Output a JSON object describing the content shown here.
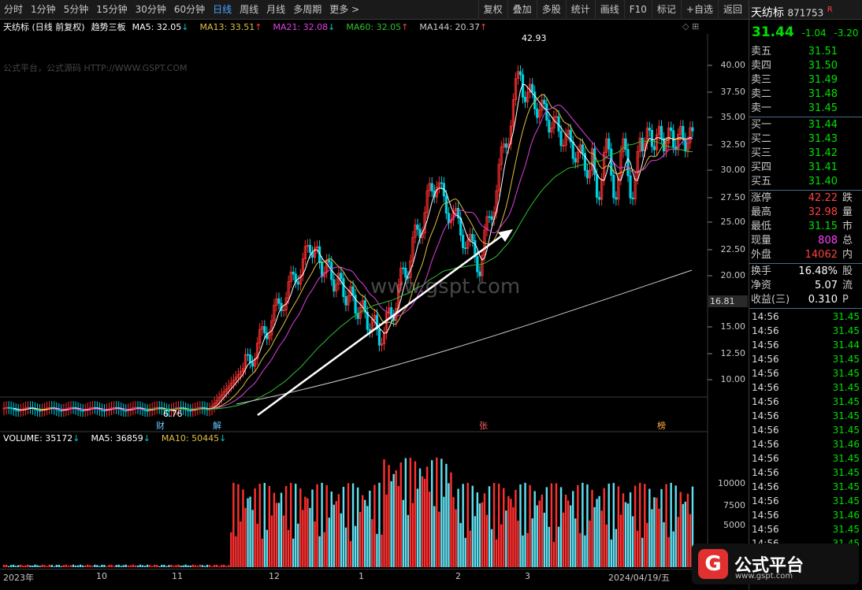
{
  "toolbar": {
    "periods": [
      "分时",
      "1分钟",
      "5分钟",
      "15分钟",
      "30分钟",
      "60分钟",
      "日线",
      "周线",
      "月线",
      "多周期",
      "更多 >"
    ],
    "active_index": 6,
    "tools": [
      "复权",
      "叠加",
      "多股",
      "统计",
      "画线",
      "F10",
      "标记",
      "+自选",
      "返回"
    ]
  },
  "chart_header": {
    "title": "天纺标 (日线 前复权)",
    "indicator": "趋势三板",
    "ma5": "MA5: 32.05",
    "ma13": "MA13: 33.51",
    "ma21": "MA21: 32.08",
    "ma60": "MA60: 32.05",
    "ma144": "MA144: 20.37"
  },
  "watermark": "公式平台，公式源码 HTTP://WWW.GSPT.COM",
  "center_watermark": "www.gspt.com",
  "price_axis": [
    "40.00",
    "37.50",
    "35.00",
    "32.50",
    "30.00",
    "27.50",
    "25.00",
    "22.50",
    "20.00",
    "15.00",
    "12.50",
    "10.00"
  ],
  "price_tag": "16.81",
  "high_label": "42.93",
  "low_label": "6.76",
  "markers": {
    "cai": "财",
    "jie": "解",
    "zhang": "张",
    "bang": "榜"
  },
  "volume_header": {
    "volume": "VOLUME: 35172",
    "ma5": "MA5: 36859",
    "ma10": "MA10: 50445"
  },
  "volume_axis": [
    "10000",
    "7500",
    "5000"
  ],
  "time_axis": [
    "2023年",
    "10",
    "11",
    "12",
    "1",
    "2",
    "3",
    "2024/04/19/五"
  ],
  "quote": {
    "name": "天纺标",
    "code": "871753",
    "flag": "R",
    "price": "31.44",
    "change": "-1.04",
    "change_pct": "-3.20",
    "orderbook": [
      {
        "k": "卖五",
        "v": "31.51"
      },
      {
        "k": "卖四",
        "v": "31.50"
      },
      {
        "k": "卖三",
        "v": "31.49"
      },
      {
        "k": "卖二",
        "v": "31.48"
      },
      {
        "k": "卖一",
        "v": "31.45"
      },
      {
        "k": "买一",
        "v": "31.44"
      },
      {
        "k": "买二",
        "v": "31.43"
      },
      {
        "k": "买三",
        "v": "31.42"
      },
      {
        "k": "买四",
        "v": "31.41"
      },
      {
        "k": "买五",
        "v": "31.40"
      }
    ],
    "stats": [
      {
        "k": "涨停",
        "v": "42.22",
        "x": "跌",
        "color": "#ff4040"
      },
      {
        "k": "最高",
        "v": "32.98",
        "x": "量",
        "color": "#ff4040"
      },
      {
        "k": "最低",
        "v": "31.15",
        "x": "市",
        "color": "#00e000"
      },
      {
        "k": "现量",
        "v": "808",
        "x": "总",
        "color": "#ff40ff"
      },
      {
        "k": "外盘",
        "v": "14062",
        "x": "内",
        "color": "#ff4040"
      },
      {
        "k": "换手",
        "v": "16.48%",
        "x": "股",
        "color": "#ffffff"
      },
      {
        "k": "净资",
        "v": "5.07",
        "x": "流",
        "color": "#ffffff"
      },
      {
        "k": "收益(三)",
        "v": "0.310",
        "x": "P",
        "color": "#ffffff"
      }
    ],
    "trades": [
      {
        "t": "14:56",
        "p": "31.45"
      },
      {
        "t": "14:56",
        "p": "31.45"
      },
      {
        "t": "14:56",
        "p": "31.44"
      },
      {
        "t": "14:56",
        "p": "31.45"
      },
      {
        "t": "14:56",
        "p": "31.45"
      },
      {
        "t": "14:56",
        "p": "31.45"
      },
      {
        "t": "14:56",
        "p": "31.45"
      },
      {
        "t": "14:56",
        "p": "31.45"
      },
      {
        "t": "14:56",
        "p": "31.45"
      },
      {
        "t": "14:56",
        "p": "31.46"
      },
      {
        "t": "14:56",
        "p": "31.45"
      },
      {
        "t": "14:56",
        "p": "31.45"
      },
      {
        "t": "14:56",
        "p": "31.45"
      },
      {
        "t": "14:56",
        "p": "31.45"
      },
      {
        "t": "14:56",
        "p": "31.46"
      },
      {
        "t": "14:56",
        "p": "31.45"
      },
      {
        "t": "14:56",
        "p": "31.45"
      }
    ]
  },
  "logo": {
    "mark": "G",
    "text": "公式平台",
    "sub": "www.gspt.com"
  },
  "colors": {
    "up": "#ff3030",
    "down": "#00d0e0",
    "ma5": "#ffffff",
    "ma13": "#e0c040",
    "ma21": "#e040e0",
    "ma60": "#30c030",
    "ma144": "#cccccc",
    "volume_up": "#ff3030",
    "volume_down": "#60e0f0"
  }
}
